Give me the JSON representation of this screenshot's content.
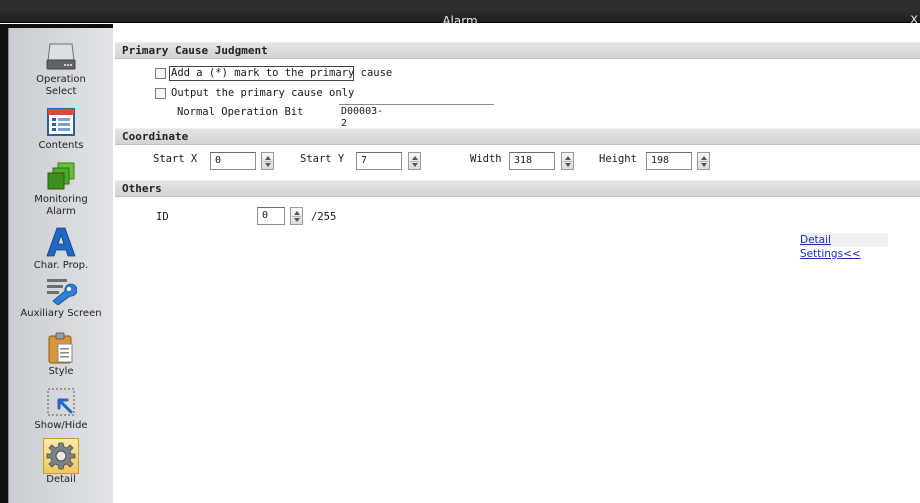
{
  "window": {
    "title": "Alarm",
    "close_glyph": "x"
  },
  "sidebar": {
    "items": [
      {
        "id": "operation-select",
        "label_lines": [
          "Operation",
          "Select"
        ],
        "icon": "drive-icon"
      },
      {
        "id": "contents",
        "label_lines": [
          "Contents"
        ],
        "icon": "list-document-icon"
      },
      {
        "id": "monitoring-alarm",
        "label_lines": [
          "Monitoring",
          "Alarm"
        ],
        "icon": "stacked-squares-icon"
      },
      {
        "id": "char-prop",
        "label_lines": [
          "Char. Prop."
        ],
        "icon": "letter-a-icon"
      },
      {
        "id": "auxiliary-screen",
        "label_lines": [
          "Auxiliary Screen"
        ],
        "icon": "wrench-lines-icon"
      },
      {
        "id": "style",
        "label_lines": [
          "Style"
        ],
        "icon": "clipboard-icon"
      },
      {
        "id": "show-hide",
        "label_lines": [
          "Show/Hide"
        ],
        "icon": "cursor-dotted-icon"
      },
      {
        "id": "detail",
        "label_lines": [
          "Detail"
        ],
        "icon": "gear-icon",
        "active": true
      }
    ]
  },
  "primary": {
    "header": "Primary Cause Judgment",
    "add_mark_label": "Add a (*) mark to the primary cause",
    "add_mark_checked": false,
    "output_only_label": "Output the primary cause only",
    "output_only_checked": false,
    "normal_op_bit_label": "Normal Operation Bit",
    "normal_op_bit_value": "D00003-2"
  },
  "coordinate": {
    "header": "Coordinate",
    "start_x_label": "Start X",
    "start_x_value": "0",
    "start_y_label": "Start Y",
    "start_y_value": "7",
    "width_label": "Width",
    "width_value": "318",
    "height_label": "Height",
    "height_value": "198"
  },
  "others": {
    "header": "Others",
    "id_label": "ID",
    "id_value": "0",
    "id_max": "/255"
  },
  "detail_settings_link": "Detail Settings<<",
  "colors": {
    "accent_link": "#1b2fa8",
    "active_tab": "#f2c661",
    "title_bar": "#2a2a2a"
  }
}
